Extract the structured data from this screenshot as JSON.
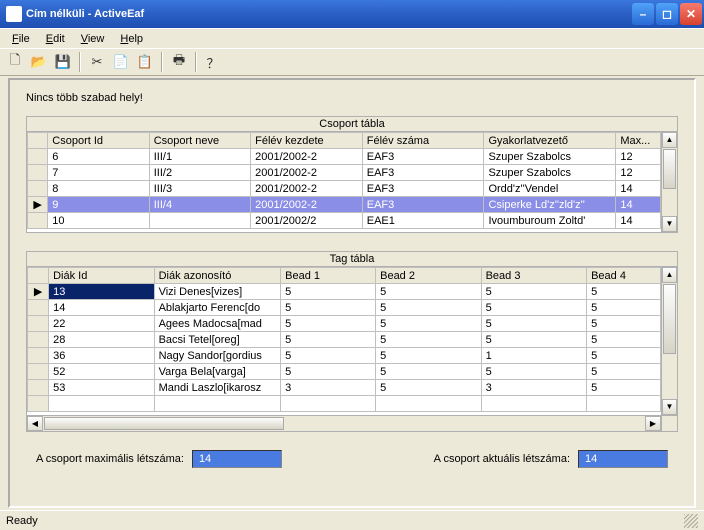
{
  "window": {
    "title": "Cím nélküli - ActiveEaf"
  },
  "menu": {
    "file": "File",
    "edit": "Edit",
    "view": "View",
    "help": "Help"
  },
  "toolbar": {
    "new": "🗋",
    "open": "📂",
    "save": "💾",
    "cut": "✂",
    "copy": "📄",
    "paste": "📋",
    "print": "🖶",
    "about": "？"
  },
  "status_msg": "Nincs több szabad hely!",
  "group_table": {
    "title": "Csoport tábla",
    "headers": [
      "Csoport Id",
      "Csoport neve",
      "Félév kezdete",
      "Félév száma",
      "Gyakorlatvezető",
      "Max..."
    ],
    "rows": [
      {
        "sel": false,
        "ptr": "",
        "cells": [
          "6",
          "III/1",
          "2001/2002-2",
          "EAF3",
          "Szuper Szabolcs",
          "12"
        ]
      },
      {
        "sel": false,
        "ptr": "",
        "cells": [
          "7",
          "III/2",
          "2001/2002-2",
          "EAF3",
          "Szuper Szabolcs",
          "12"
        ]
      },
      {
        "sel": false,
        "ptr": "",
        "cells": [
          "8",
          "III/3",
          "2001/2002-2",
          "EAF3",
          "Ordd'z''Vendel",
          "14"
        ]
      },
      {
        "sel": true,
        "ptr": "▶",
        "cells": [
          "9",
          "III/4",
          "2001/2002-2",
          "EAF3",
          "Csiperke Ld'z''zld'z''",
          "14"
        ]
      },
      {
        "sel": false,
        "ptr": "",
        "cells": [
          "10",
          "",
          "2001/2002/2",
          "EAE1",
          "Ivoumburoum Zoltd'",
          "14"
        ]
      }
    ]
  },
  "member_table": {
    "title": "Tag tábla",
    "headers": [
      "Diák Id",
      "Diák azonosító",
      "Bead 1",
      "Bead 2",
      "Bead 3",
      "Bead 4"
    ],
    "rows": [
      {
        "ptr": "▶",
        "cells": [
          "13",
          "Vizi Denes[vizes]",
          "5",
          "5",
          "5",
          "5"
        ],
        "cellsel": 0
      },
      {
        "ptr": "",
        "cells": [
          "14",
          "Ablakjarto Ferenc[do",
          "5",
          "5",
          "5",
          "5"
        ]
      },
      {
        "ptr": "",
        "cells": [
          "22",
          "Agees Madocsa[mad",
          "5",
          "5",
          "5",
          "5"
        ]
      },
      {
        "ptr": "",
        "cells": [
          "28",
          "Bacsi Tetel[oreg]",
          "5",
          "5",
          "5",
          "5"
        ]
      },
      {
        "ptr": "",
        "cells": [
          "36",
          "Nagy Sandor[gordius",
          "5",
          "5",
          "1",
          "5"
        ]
      },
      {
        "ptr": "",
        "cells": [
          "52",
          "Varga Bela[varga]",
          "5",
          "5",
          "5",
          "5"
        ]
      },
      {
        "ptr": "",
        "cells": [
          "53",
          "Mandi Laszlo[ikarosz",
          "3",
          "5",
          "3",
          "5"
        ]
      },
      {
        "ptr": "",
        "cells": [
          "",
          "",
          "",
          "",
          "",
          ""
        ]
      }
    ]
  },
  "footer": {
    "max_label": "A csoport maximális létszáma:",
    "max_value": "14",
    "cur_label": "A csoport aktuális létszáma:",
    "cur_value": "14"
  },
  "statusbar": {
    "text": "Ready"
  }
}
